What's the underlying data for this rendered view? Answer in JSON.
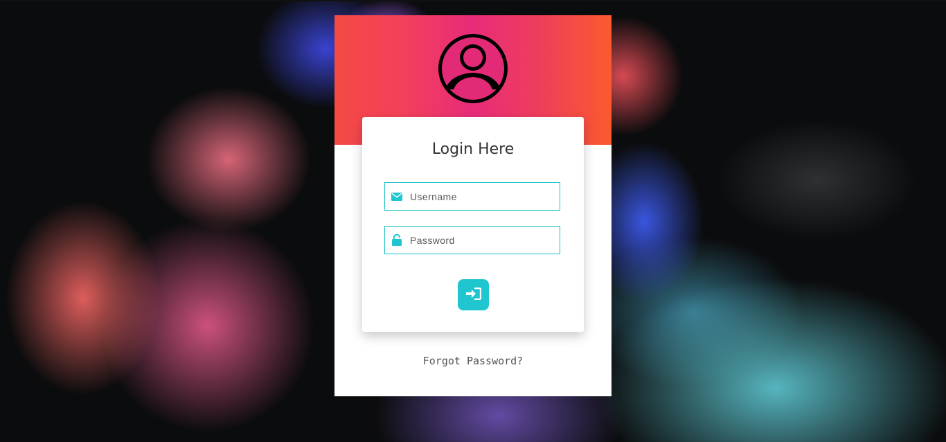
{
  "colors": {
    "header_gradient": [
      "#f44a44",
      "#e82b7a",
      "#fb5a2e"
    ],
    "accent": "#1fc5cf",
    "field_border": "#19bec8"
  },
  "login": {
    "title": "Login Here",
    "username": {
      "placeholder": "Username",
      "value": "",
      "icon": "envelope-icon"
    },
    "password": {
      "placeholder": "Password",
      "value": "",
      "icon": "unlock-icon"
    },
    "submit_icon": "sign-in-icon",
    "forgot_label": "Forgot Password?",
    "avatar_icon": "user-circle-icon"
  }
}
